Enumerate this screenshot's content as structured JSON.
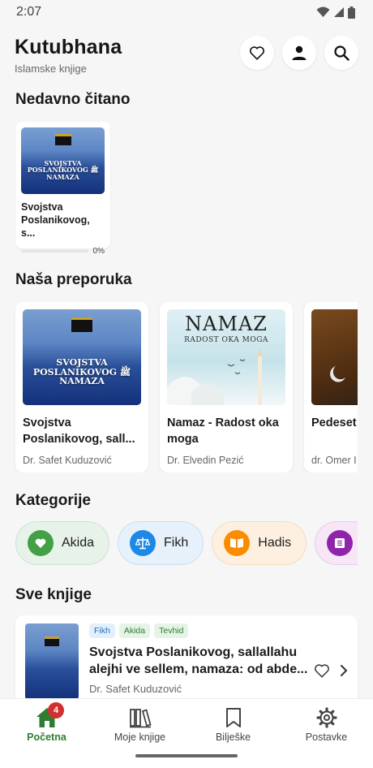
{
  "status": {
    "time": "2:07"
  },
  "header": {
    "title": "Kutubhana",
    "subtitle": "Islamske knjige"
  },
  "sections": {
    "recent": "Nedavno čitano",
    "recommended": "Naša preporuka",
    "categories": "Kategorije",
    "all_books": "Sve knjige"
  },
  "recent": [
    {
      "title": "Svojstva Poslanikovog, s...",
      "progress_label": "0%",
      "progress": 0,
      "cover_text": "SVOJSTVA POSLANIKOVOG ﷺ NAMAZA"
    }
  ],
  "recommended": [
    {
      "title": "Svojstva Poslanikovog, sall...",
      "author": "Dr. Safet Kuduzović",
      "cover_text": "SVOJSTVA POSLANIKOVOG ﷺ NAMAZA"
    },
    {
      "title": "Namaz - Radost oka moga",
      "author": "Dr. Elvedin Pezić",
      "cover_title": "NAMAZ",
      "cover_subtitle": "RADOST OKA MOGA"
    },
    {
      "title": "Pedeset pravila",
      "author": "dr. Omer I"
    }
  ],
  "categories": [
    {
      "label": "Akida",
      "icon": "heart-icon",
      "bg": "#e7f2e8",
      "border": "#cde4cf",
      "icon_bg": "#43a047"
    },
    {
      "label": "Fikh",
      "icon": "scales-icon",
      "bg": "#e6f1fb",
      "border": "#c9e0f5",
      "icon_bg": "#1e88e5"
    },
    {
      "label": "Hadis",
      "icon": "book-open-icon",
      "bg": "#fdf0e1",
      "border": "#f6dcbc",
      "icon_bg": "#fb8c00"
    },
    {
      "label": "",
      "icon": "book-icon",
      "bg": "#f6e6f6",
      "border": "#ebcdeb",
      "icon_bg": "#8e24aa"
    }
  ],
  "books": [
    {
      "tags": [
        {
          "label": "Fikh",
          "bg": "#e3f0fb",
          "color": "#1e6fb8"
        },
        {
          "label": "Akida",
          "bg": "#e5f4e6",
          "color": "#2e7d32"
        },
        {
          "label": "Tevhid",
          "bg": "#e5f4e6",
          "color": "#2e7d32"
        }
      ],
      "title": "Svojstva Poslanikovog, sallallahu alejhi ve sellem, namaza: od abde...",
      "author": "Dr. Safet Kuduzović"
    }
  ],
  "nav": {
    "items": [
      {
        "label": "Početna",
        "icon": "home-icon",
        "active": true,
        "badge": "4"
      },
      {
        "label": "Moje knjige",
        "icon": "library-icon"
      },
      {
        "label": "Bilješke",
        "icon": "bookmark-icon"
      },
      {
        "label": "Postavke",
        "icon": "gear-icon"
      }
    ]
  },
  "colors": {
    "accent": "#2e7d32",
    "badge": "#d32f2f"
  }
}
